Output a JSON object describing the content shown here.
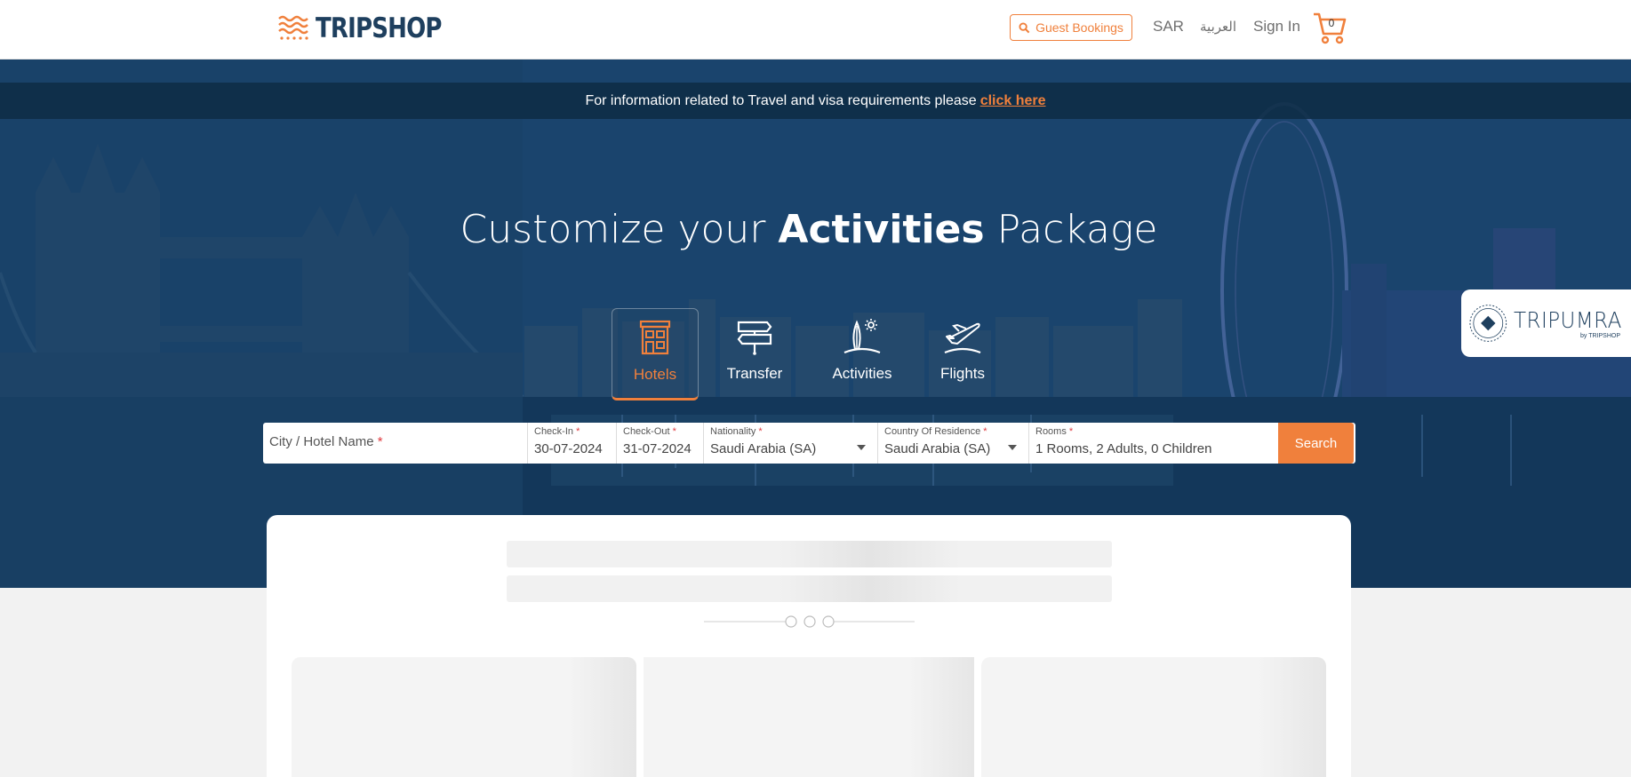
{
  "header": {
    "logo_text": "TRIPSHOP",
    "guest_bookings": "Guest Bookings",
    "currency": "SAR",
    "language": "العربية",
    "sign_in": "Sign In",
    "cart_count": "0"
  },
  "banner": {
    "text": "For information related to Travel and visa requirements please",
    "link": "click here"
  },
  "hero": {
    "title_pre": "Customize your",
    "title_bold": "Activities",
    "title_post": "Package"
  },
  "tabs": [
    {
      "label": "Hotels",
      "icon": "hotel-icon",
      "active": true
    },
    {
      "label": "Transfer",
      "icon": "signpost-icon",
      "active": false
    },
    {
      "label": "Activities",
      "icon": "beach-activities-icon",
      "active": false
    },
    {
      "label": "Flights",
      "icon": "plane-icon",
      "active": false
    }
  ],
  "search": {
    "city_placeholder": "City / Hotel Name",
    "required_mark": "*",
    "checkin_label": "Check-In",
    "checkin_value": "30-07-2024",
    "checkout_label": "Check-Out",
    "checkout_value": "31-07-2024",
    "nationality_label": "Nationality",
    "nationality_value": "Saudi Arabia (SA)",
    "residence_label": "Country Of Residence",
    "residence_value": "Saudi Arabia (SA)",
    "rooms_label": "Rooms",
    "rooms_value": "1 Rooms, 2 Adults, 0 Children",
    "button": "Search"
  },
  "tripumra": {
    "name": "TRIPUMRA",
    "sub": "by TRIPSHOP"
  },
  "colors": {
    "accent": "#f0803c",
    "brand_navy": "#1e3f5e"
  }
}
